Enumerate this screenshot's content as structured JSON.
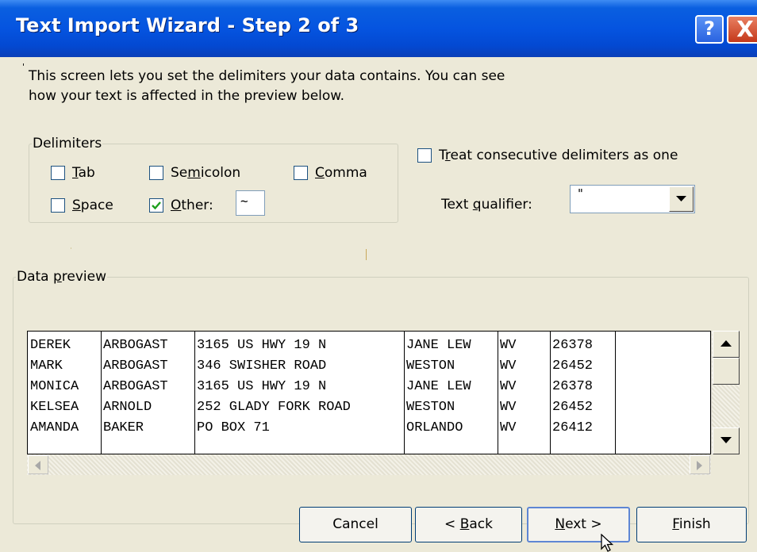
{
  "window": {
    "title": "Text Import Wizard - Step 2 of 3",
    "help_glyph": "?",
    "close_glyph": "X"
  },
  "description": {
    "marker": "'",
    "line1": "This screen lets you set the delimiters your data contains.  You can see",
    "line2": "how your text is affected in the preview below."
  },
  "delimiters": {
    "legend": "Delimiters",
    "tab": {
      "access": "T",
      "rest": "ab",
      "checked": false
    },
    "semicolon": {
      "pre": "Se",
      "access": "m",
      "rest": "icolon",
      "checked": false
    },
    "comma": {
      "access": "C",
      "rest": "omma",
      "checked": false
    },
    "space": {
      "access": "S",
      "rest": "pace",
      "checked": false
    },
    "other": {
      "access": "O",
      "rest": "ther:",
      "checked": true,
      "value": "~"
    }
  },
  "consecutive": {
    "pre": "T",
    "access": "r",
    "rest": "eat consecutive delimiters as one",
    "checked": false
  },
  "qualifier": {
    "pre": "Text ",
    "access": "q",
    "rest": "ualifier:",
    "value": "\""
  },
  "preview": {
    "legend_pre": "Data ",
    "legend_access": "p",
    "legend_rest": "review",
    "rows": [
      [
        "DEREK",
        "ARBOGAST",
        "3165 US HWY 19 N",
        "JANE LEW",
        "WV",
        "26378"
      ],
      [
        "MARK",
        "ARBOGAST",
        "346 SWISHER ROAD",
        "WESTON",
        "WV",
        "26452"
      ],
      [
        "MONICA",
        "ARBOGAST",
        "3165 US HWY 19 N",
        "JANE LEW",
        "WV",
        "26378"
      ],
      [
        "KELSEA",
        "ARNOLD",
        "252 GLADY FORK ROAD",
        "WESTON",
        "WV",
        "26452"
      ],
      [
        "AMANDA",
        "BAKER",
        "PO BOX 71",
        "ORLANDO",
        "WV",
        "26412"
      ]
    ]
  },
  "buttons": {
    "cancel": {
      "label": "Cancel"
    },
    "back": {
      "pre": "< ",
      "access": "B",
      "rest": "ack"
    },
    "next": {
      "access": "N",
      "rest": "ext >"
    },
    "finish": {
      "access": "F",
      "rest": "inish"
    }
  }
}
